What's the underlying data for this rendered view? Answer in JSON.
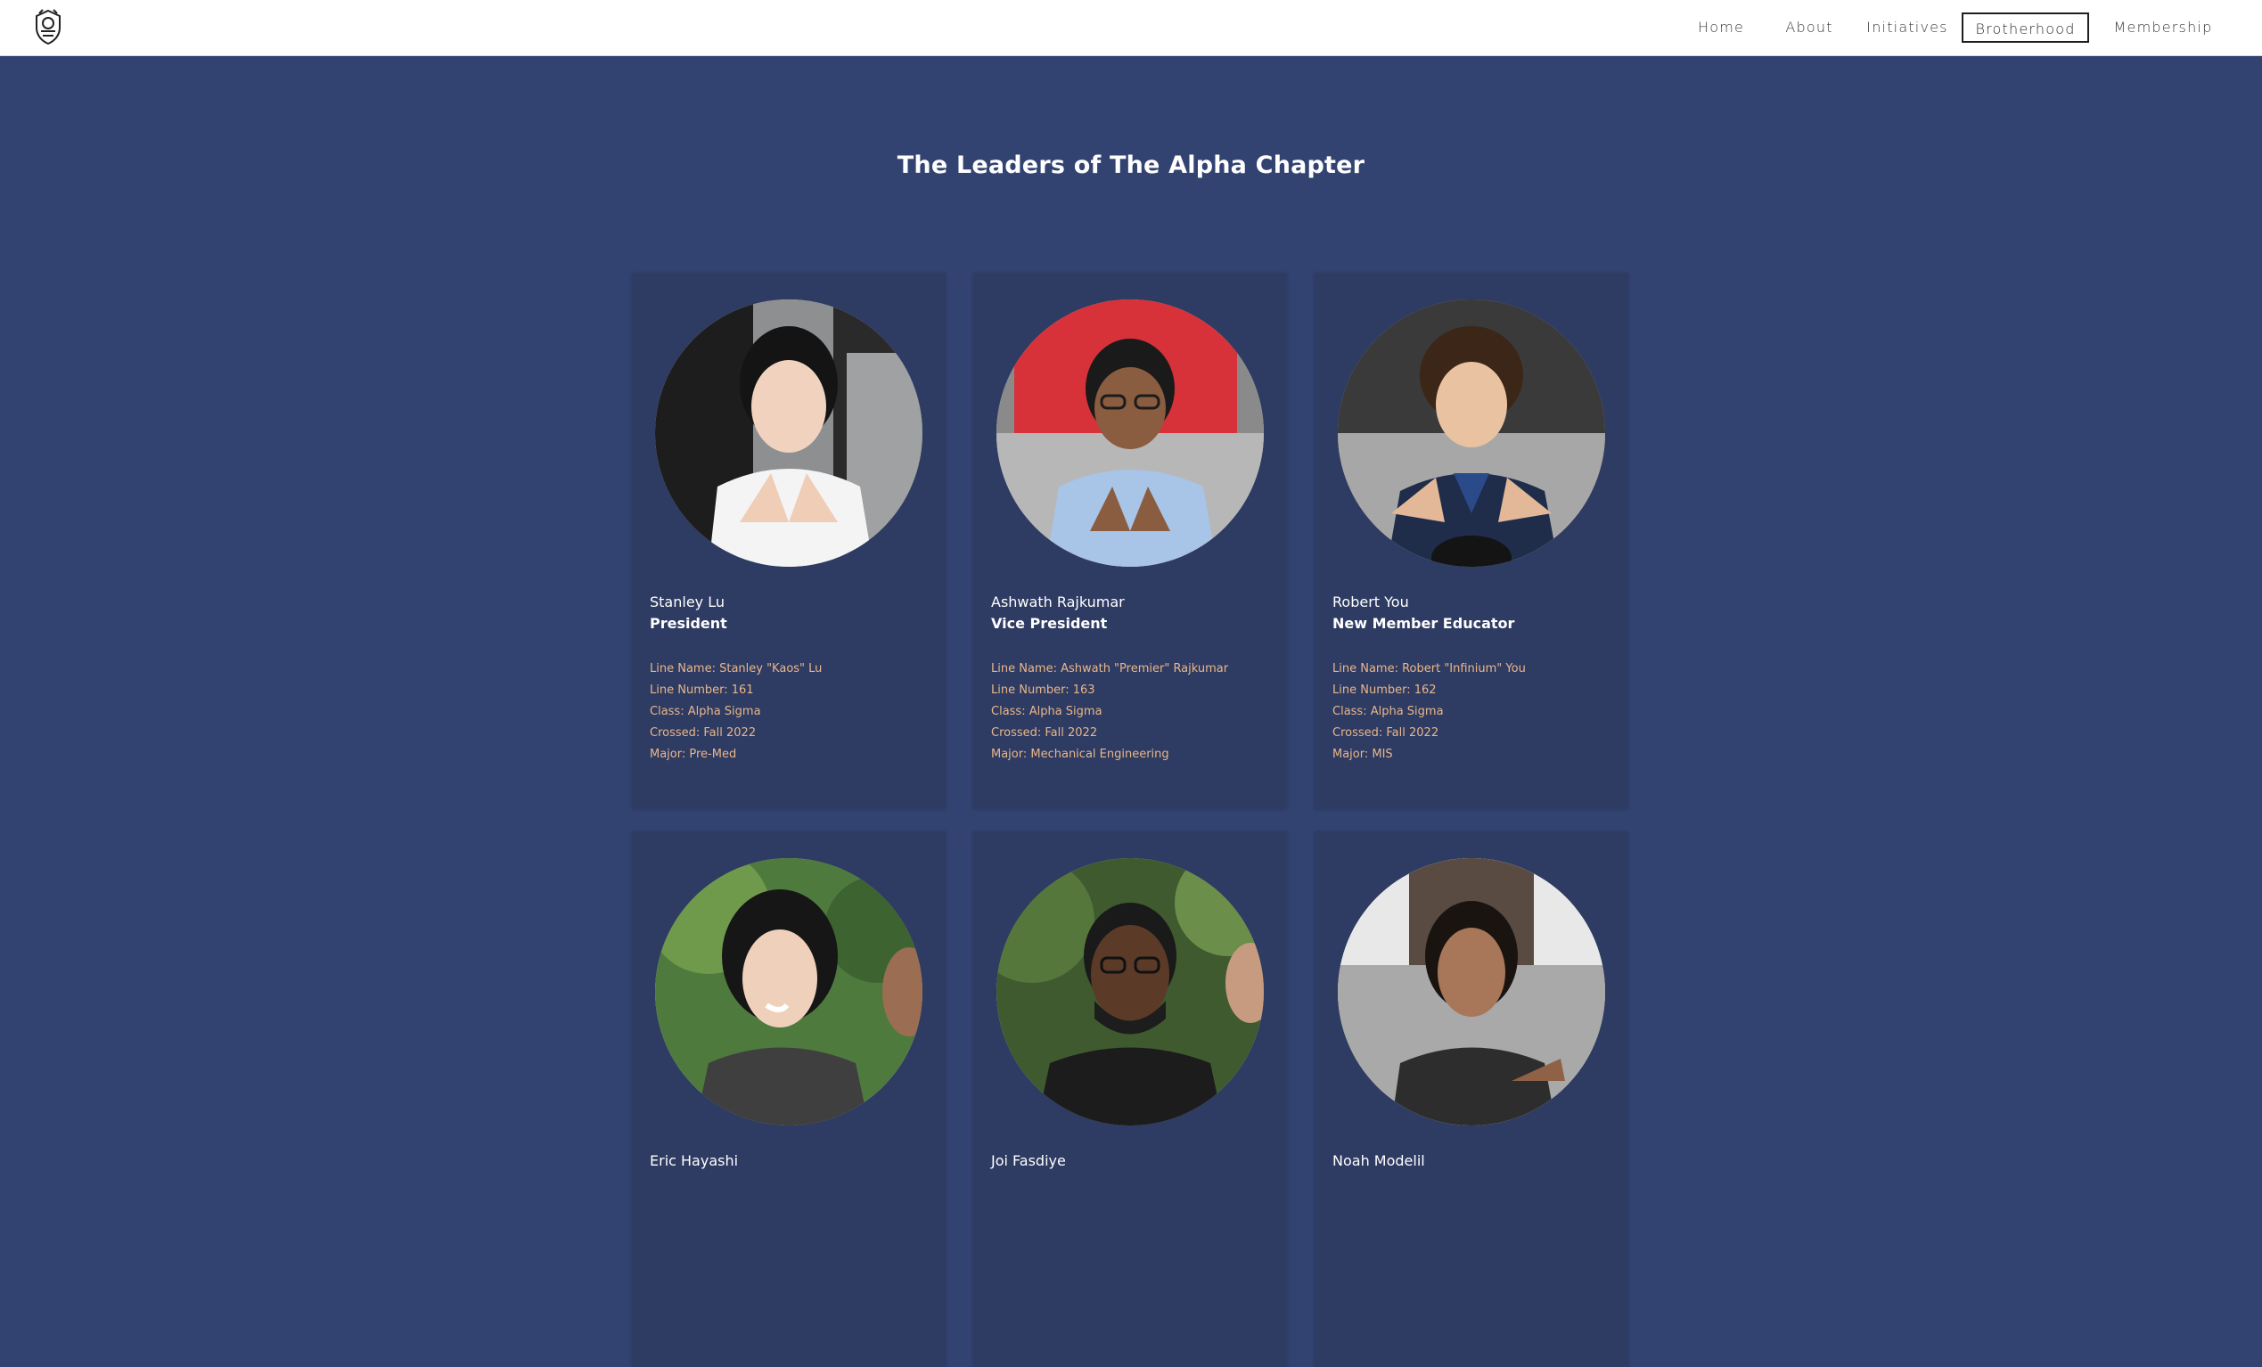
{
  "nav": {
    "logo": "fraternity-crest-logo",
    "items": [
      {
        "label": "Home",
        "active": false
      },
      {
        "label": "About",
        "active": false
      },
      {
        "label": "Initiatives",
        "active": false
      },
      {
        "label": "Brotherhood",
        "active": true
      },
      {
        "label": "Membership",
        "active": false
      }
    ]
  },
  "page": {
    "title": "The Leaders of The Alpha Chapter"
  },
  "members": [
    {
      "name": "Stanley Lu",
      "role": "President",
      "line_name": "Line Name: Stanley \"Kaos\" Lu",
      "line_number": "Line Number: 161",
      "class": "Class: Alpha Sigma",
      "crossed": "Crossed: Fall 2022",
      "major": "Major: Pre-Med"
    },
    {
      "name": "Ashwath Rajkumar",
      "role": "Vice President",
      "line_name": "Line Name: Ashwath \"Premier\" Rajkumar",
      "line_number": "Line Number: 163",
      "class": "Class: Alpha Sigma",
      "crossed": "Crossed: Fall 2022",
      "major": "Major: Mechanical Engineering"
    },
    {
      "name": "Robert You",
      "role": "New Member Educator",
      "line_name": "Line Name: Robert \"Infinium\" You",
      "line_number": "Line Number: 162",
      "class": "Class: Alpha Sigma",
      "crossed": "Crossed: Fall 2022",
      "major": "Major: MIS"
    },
    {
      "name": "Eric Hayashi",
      "role": "",
      "line_name": "",
      "line_number": "",
      "class": "",
      "crossed": "",
      "major": ""
    },
    {
      "name": "Joi Fasdiye",
      "role": "",
      "line_name": "",
      "line_number": "",
      "class": "",
      "crossed": "",
      "major": ""
    },
    {
      "name": "Noah Modelil",
      "role": "",
      "line_name": "",
      "line_number": "",
      "class": "",
      "crossed": "",
      "major": ""
    }
  ],
  "colors": {
    "page_background": "#324372",
    "card_background": "#2e3b62",
    "detail_text": "#e9b68a",
    "nav_background": "#ffffff"
  }
}
